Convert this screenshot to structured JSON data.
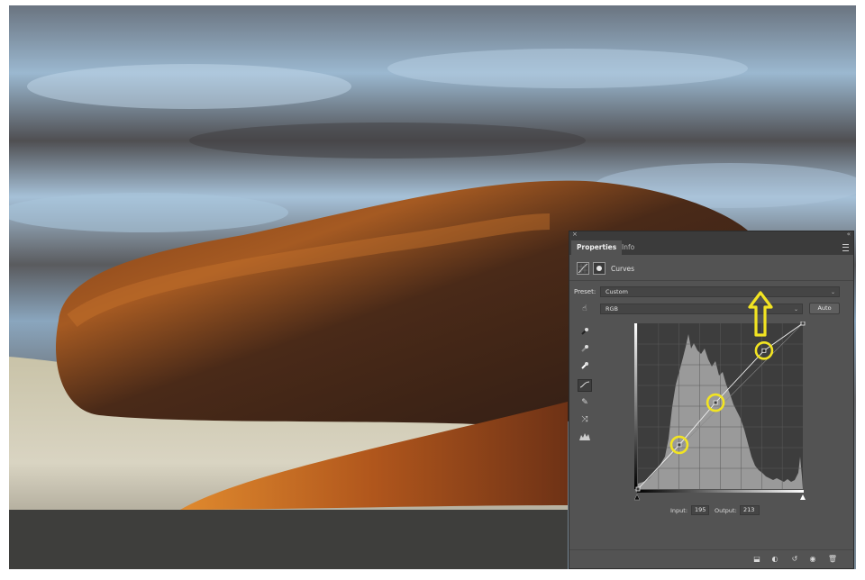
{
  "panel": {
    "tabs": [
      {
        "label": "Properties",
        "active": true
      },
      {
        "label": "Info",
        "active": false
      }
    ],
    "adjustment_title": "Curves",
    "preset_label": "Preset:",
    "preset_value": "Custom",
    "channel_value": "RGB",
    "auto_label": "Auto",
    "input_label": "Input:",
    "input_value": "195",
    "output_label": "Output:",
    "output_value": "213"
  },
  "curve_points": [
    {
      "input": 0,
      "output": 0
    },
    {
      "input": 64,
      "output": 68
    },
    {
      "input": 120,
      "output": 133
    },
    {
      "input": 195,
      "output": 213
    },
    {
      "input": 255,
      "output": 255
    }
  ],
  "icons": {
    "sample_tool": "finger-scrub-icon",
    "tools": [
      "black-eyedropper-icon",
      "gray-eyedropper-icon",
      "white-eyedropper-icon",
      "curve-point-icon",
      "pencil-icon",
      "smooth-icon",
      "clipping-warning-icon"
    ],
    "bottom": [
      "clip-to-layer-icon",
      "view-previous-icon",
      "reset-icon",
      "visibility-icon",
      "delete-icon"
    ]
  },
  "colors": {
    "highlight": "#f2e422",
    "panel_bg": "#535353"
  }
}
